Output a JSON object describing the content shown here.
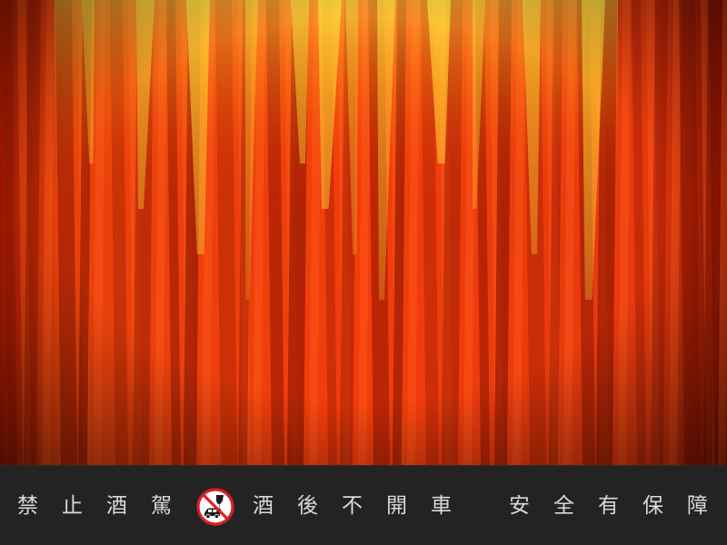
{
  "scene": {
    "subject": "red-stage-curtain",
    "colors": {
      "curtain_red": "#e83a0c",
      "curtain_highlight": "#f7d23a",
      "curtain_shadow": "#7a0d00",
      "footer_bg": "#232323",
      "footer_text": "#d9d9d9",
      "sign_red": "#d6202a"
    }
  },
  "footer": {
    "left_text": "禁止酒駕",
    "middle_text": "酒後不開車",
    "right_text": "安全有保障",
    "icon": "no-drink-driving-icon"
  }
}
